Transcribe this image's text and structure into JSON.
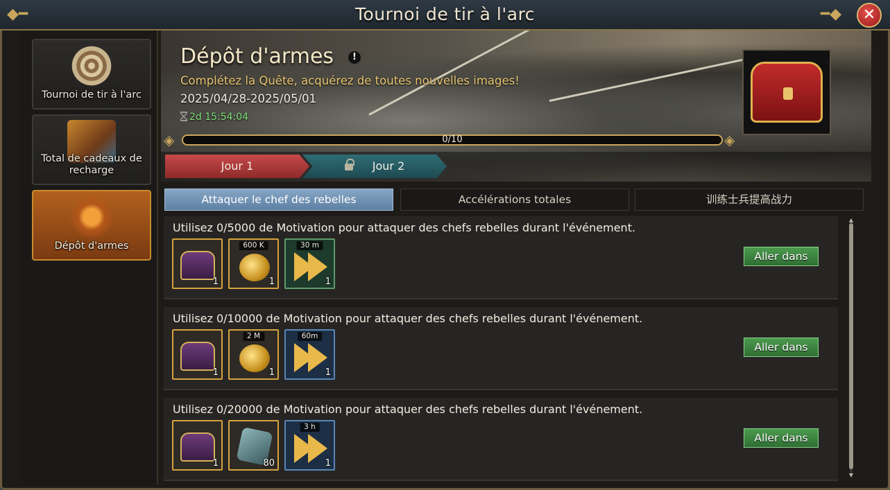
{
  "window": {
    "title": "Tournoi de tir à l'arc",
    "close_label": "✕"
  },
  "sidebar": {
    "items": [
      {
        "label": "Tournoi de tir à l'arc",
        "icon": "target-icon"
      },
      {
        "label": "Total de cadeaux de recharge",
        "icon": "gift-pile-icon"
      },
      {
        "label": "Dépôt d'armes",
        "icon": "sword-icon",
        "active": true
      }
    ]
  },
  "banner": {
    "title": "Dépôt d'armes",
    "info_label": "!",
    "subtitle": "Complétez la Quête, acquérez de toutes nouvelles images!",
    "dates": "2025/04/28-2025/05/01",
    "timer": "2d 15:54:04",
    "progress": {
      "current": 0,
      "max": 10,
      "text": "0/10"
    }
  },
  "day_tabs": [
    {
      "label": "Jour 1",
      "active": true
    },
    {
      "label": "Jour 2",
      "locked": true
    }
  ],
  "sub_tabs": [
    {
      "label": "Attaquer le chef des rebelles",
      "active": true
    },
    {
      "label": "Accélérations totales"
    },
    {
      "label": "训练士兵提高战力"
    }
  ],
  "quests": [
    {
      "text": "Utilisez 0/5000 de Motivation pour attaquer des chefs rebelles durant l'événement.",
      "button": "Aller dans",
      "rewards": [
        {
          "type": "chest-icon",
          "count": "1",
          "tag": ""
        },
        {
          "type": "gold-coins-icon",
          "count": "1",
          "tag": "600 K"
        },
        {
          "type": "speedup-icon",
          "count": "1",
          "tag": "30 m"
        }
      ]
    },
    {
      "text": "Utilisez 0/10000 de Motivation pour attaquer des chefs rebelles durant l'événement.",
      "button": "Aller dans",
      "rewards": [
        {
          "type": "chest-icon",
          "count": "1",
          "tag": ""
        },
        {
          "type": "gold-coins-icon",
          "count": "1",
          "tag": "2 M"
        },
        {
          "type": "speedup-icon",
          "count": "1",
          "tag": "60m"
        }
      ]
    },
    {
      "text": "Utilisez 0/20000 de Motivation pour attaquer des chefs rebelles durant l'événement.",
      "button": "Aller dans",
      "rewards": [
        {
          "type": "chest-icon",
          "count": "1",
          "tag": ""
        },
        {
          "type": "gem-shard-icon",
          "count": "80",
          "tag": ""
        },
        {
          "type": "speedup-icon",
          "count": "1",
          "tag": "3 h"
        }
      ]
    }
  ],
  "colors": {
    "accent_gold": "#d7a33e",
    "button_green": "#3f8a43",
    "active_tab_blue": "#7596b6",
    "day1_red": "#b13b3b"
  }
}
